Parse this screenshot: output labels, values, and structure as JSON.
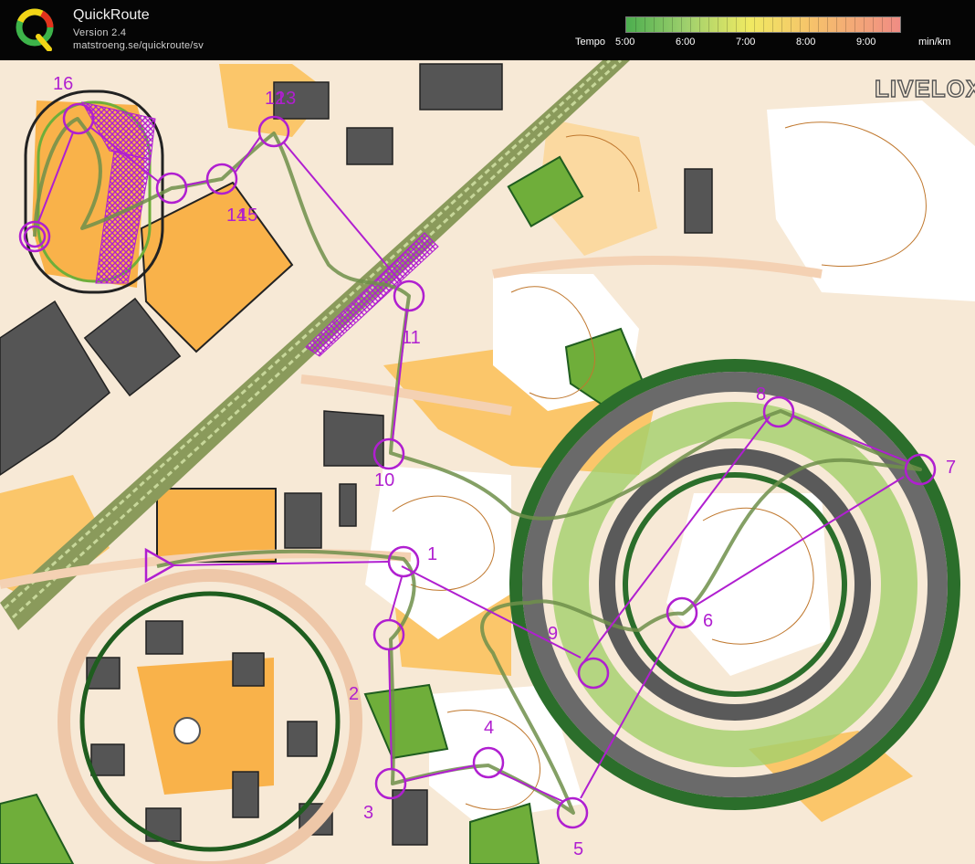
{
  "app": {
    "title": "QuickRoute",
    "version": "Version 2.4",
    "url": "matstroeng.se/quickroute/sv"
  },
  "tempo": {
    "label": "Tempo",
    "ticks": [
      "5:00",
      "6:00",
      "7:00",
      "8:00",
      "9:00"
    ],
    "unit": "min/km",
    "colors": {
      "fast": "#4cae4f",
      "mid": "#f0ea62",
      "slow": "#f08c84"
    }
  },
  "map": {
    "watermark": "LIVELOX",
    "course_color": "#b01fd0",
    "route_color": "#6e8f4a",
    "controls": [
      {
        "label": "1"
      },
      {
        "label": "2"
      },
      {
        "label": "3"
      },
      {
        "label": "4"
      },
      {
        "label": "5"
      },
      {
        "label": "6"
      },
      {
        "label": "7"
      },
      {
        "label": "8"
      },
      {
        "label": "9"
      },
      {
        "label": "10"
      },
      {
        "label": "11"
      },
      {
        "label": "12"
      },
      {
        "label": "13"
      },
      {
        "label": "14"
      },
      {
        "label": "15"
      },
      {
        "label": "16"
      }
    ]
  }
}
